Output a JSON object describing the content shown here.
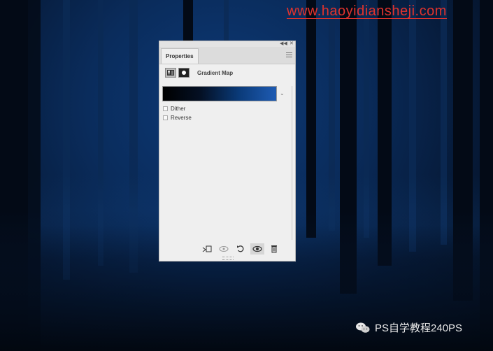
{
  "watermark": {
    "text": "www.haoyidiansheji.com"
  },
  "wechat": {
    "account": "PS自学教程240PS"
  },
  "panel": {
    "tab_label": "Properties",
    "adjustment_title": "Gradient Map",
    "gradient": {
      "stops": [
        "#000000",
        "#041024",
        "#0a3a78",
        "#1e5bb3"
      ]
    },
    "options": [
      {
        "label": "Dither",
        "checked": false
      },
      {
        "label": "Reverse",
        "checked": false
      }
    ],
    "bottom_tools": [
      {
        "name": "clip-to-layer",
        "icon": "clip-icon"
      },
      {
        "name": "view-previous-state",
        "icon": "eye-previous-icon"
      },
      {
        "name": "reset",
        "icon": "reset-icon"
      },
      {
        "name": "toggle-visibility",
        "icon": "eye-icon"
      },
      {
        "name": "delete",
        "icon": "trash-icon"
      }
    ]
  },
  "colors": {
    "background": "#0a2c5c",
    "watermark": "#e0332d",
    "panel": "#efefef"
  }
}
